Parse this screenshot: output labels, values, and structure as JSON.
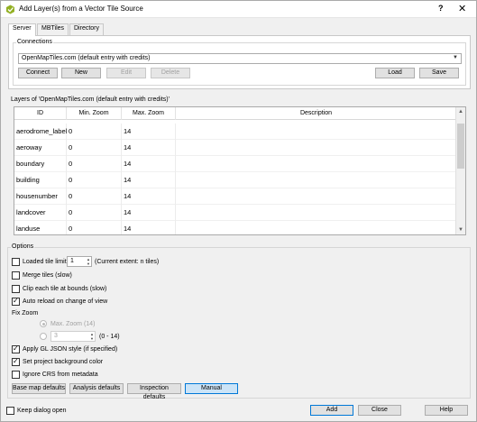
{
  "window": {
    "title": "Add Layer(s) from a Vector Tile Source",
    "help_glyph": "?",
    "close_glyph": "✕"
  },
  "tabs": [
    "Server",
    "MBTiles",
    "Directory"
  ],
  "connections": {
    "legend": "Connections",
    "selected": "OpenMapTiles.com (default entry with credits)",
    "buttons": {
      "connect": "Connect",
      "new": "New",
      "edit": "Edit",
      "delete": "Delete",
      "load": "Load",
      "save": "Save"
    }
  },
  "layers": {
    "label": "Layers of 'OpenMapTiles.com (default entry with credits)'",
    "columns": [
      "ID",
      "Min. Zoom",
      "Max. Zoom",
      "Description"
    ],
    "rows": [
      {
        "id": "aerodrome_label",
        "min": "0",
        "max": "14",
        "desc": ""
      },
      {
        "id": "aeroway",
        "min": "0",
        "max": "14",
        "desc": ""
      },
      {
        "id": "boundary",
        "min": "0",
        "max": "14",
        "desc": ""
      },
      {
        "id": "building",
        "min": "0",
        "max": "14",
        "desc": ""
      },
      {
        "id": "housenumber",
        "min": "0",
        "max": "14",
        "desc": ""
      },
      {
        "id": "landcover",
        "min": "0",
        "max": "14",
        "desc": ""
      },
      {
        "id": "landuse",
        "min": "0",
        "max": "14",
        "desc": ""
      }
    ]
  },
  "options": {
    "legend": "Options",
    "loaded_tile_limit": {
      "label": "Loaded tile limit",
      "value": "1",
      "note": "(Current extent: n tiles)",
      "checked": false
    },
    "merge_tiles": {
      "label": "Merge tiles (slow)",
      "checked": false
    },
    "clip_tiles": {
      "label": "Clip each tile at bounds (slow)",
      "checked": false
    },
    "auto_reload": {
      "label": "Auto reload on change of view",
      "checked": true
    },
    "fix_zoom": {
      "label": "Fix Zoom",
      "max_zoom": "Max. Zoom (14)",
      "custom_value": "3",
      "range": "(0 - 14)"
    },
    "apply_gl_style": {
      "label": "Apply GL JSON style (if specified)",
      "checked": true
    },
    "set_bg_color": {
      "label": "Set project background color",
      "checked": true
    },
    "ignore_crs": {
      "label": "Ignore CRS from metadata",
      "checked": false
    },
    "presets": [
      "Base map defaults",
      "Analysis defaults",
      "Inspection defaults",
      "Manual"
    ]
  },
  "footer": {
    "keep_open": {
      "label": "Keep dialog open",
      "checked": false
    },
    "add": "Add",
    "close": "Close",
    "help": "Help"
  }
}
